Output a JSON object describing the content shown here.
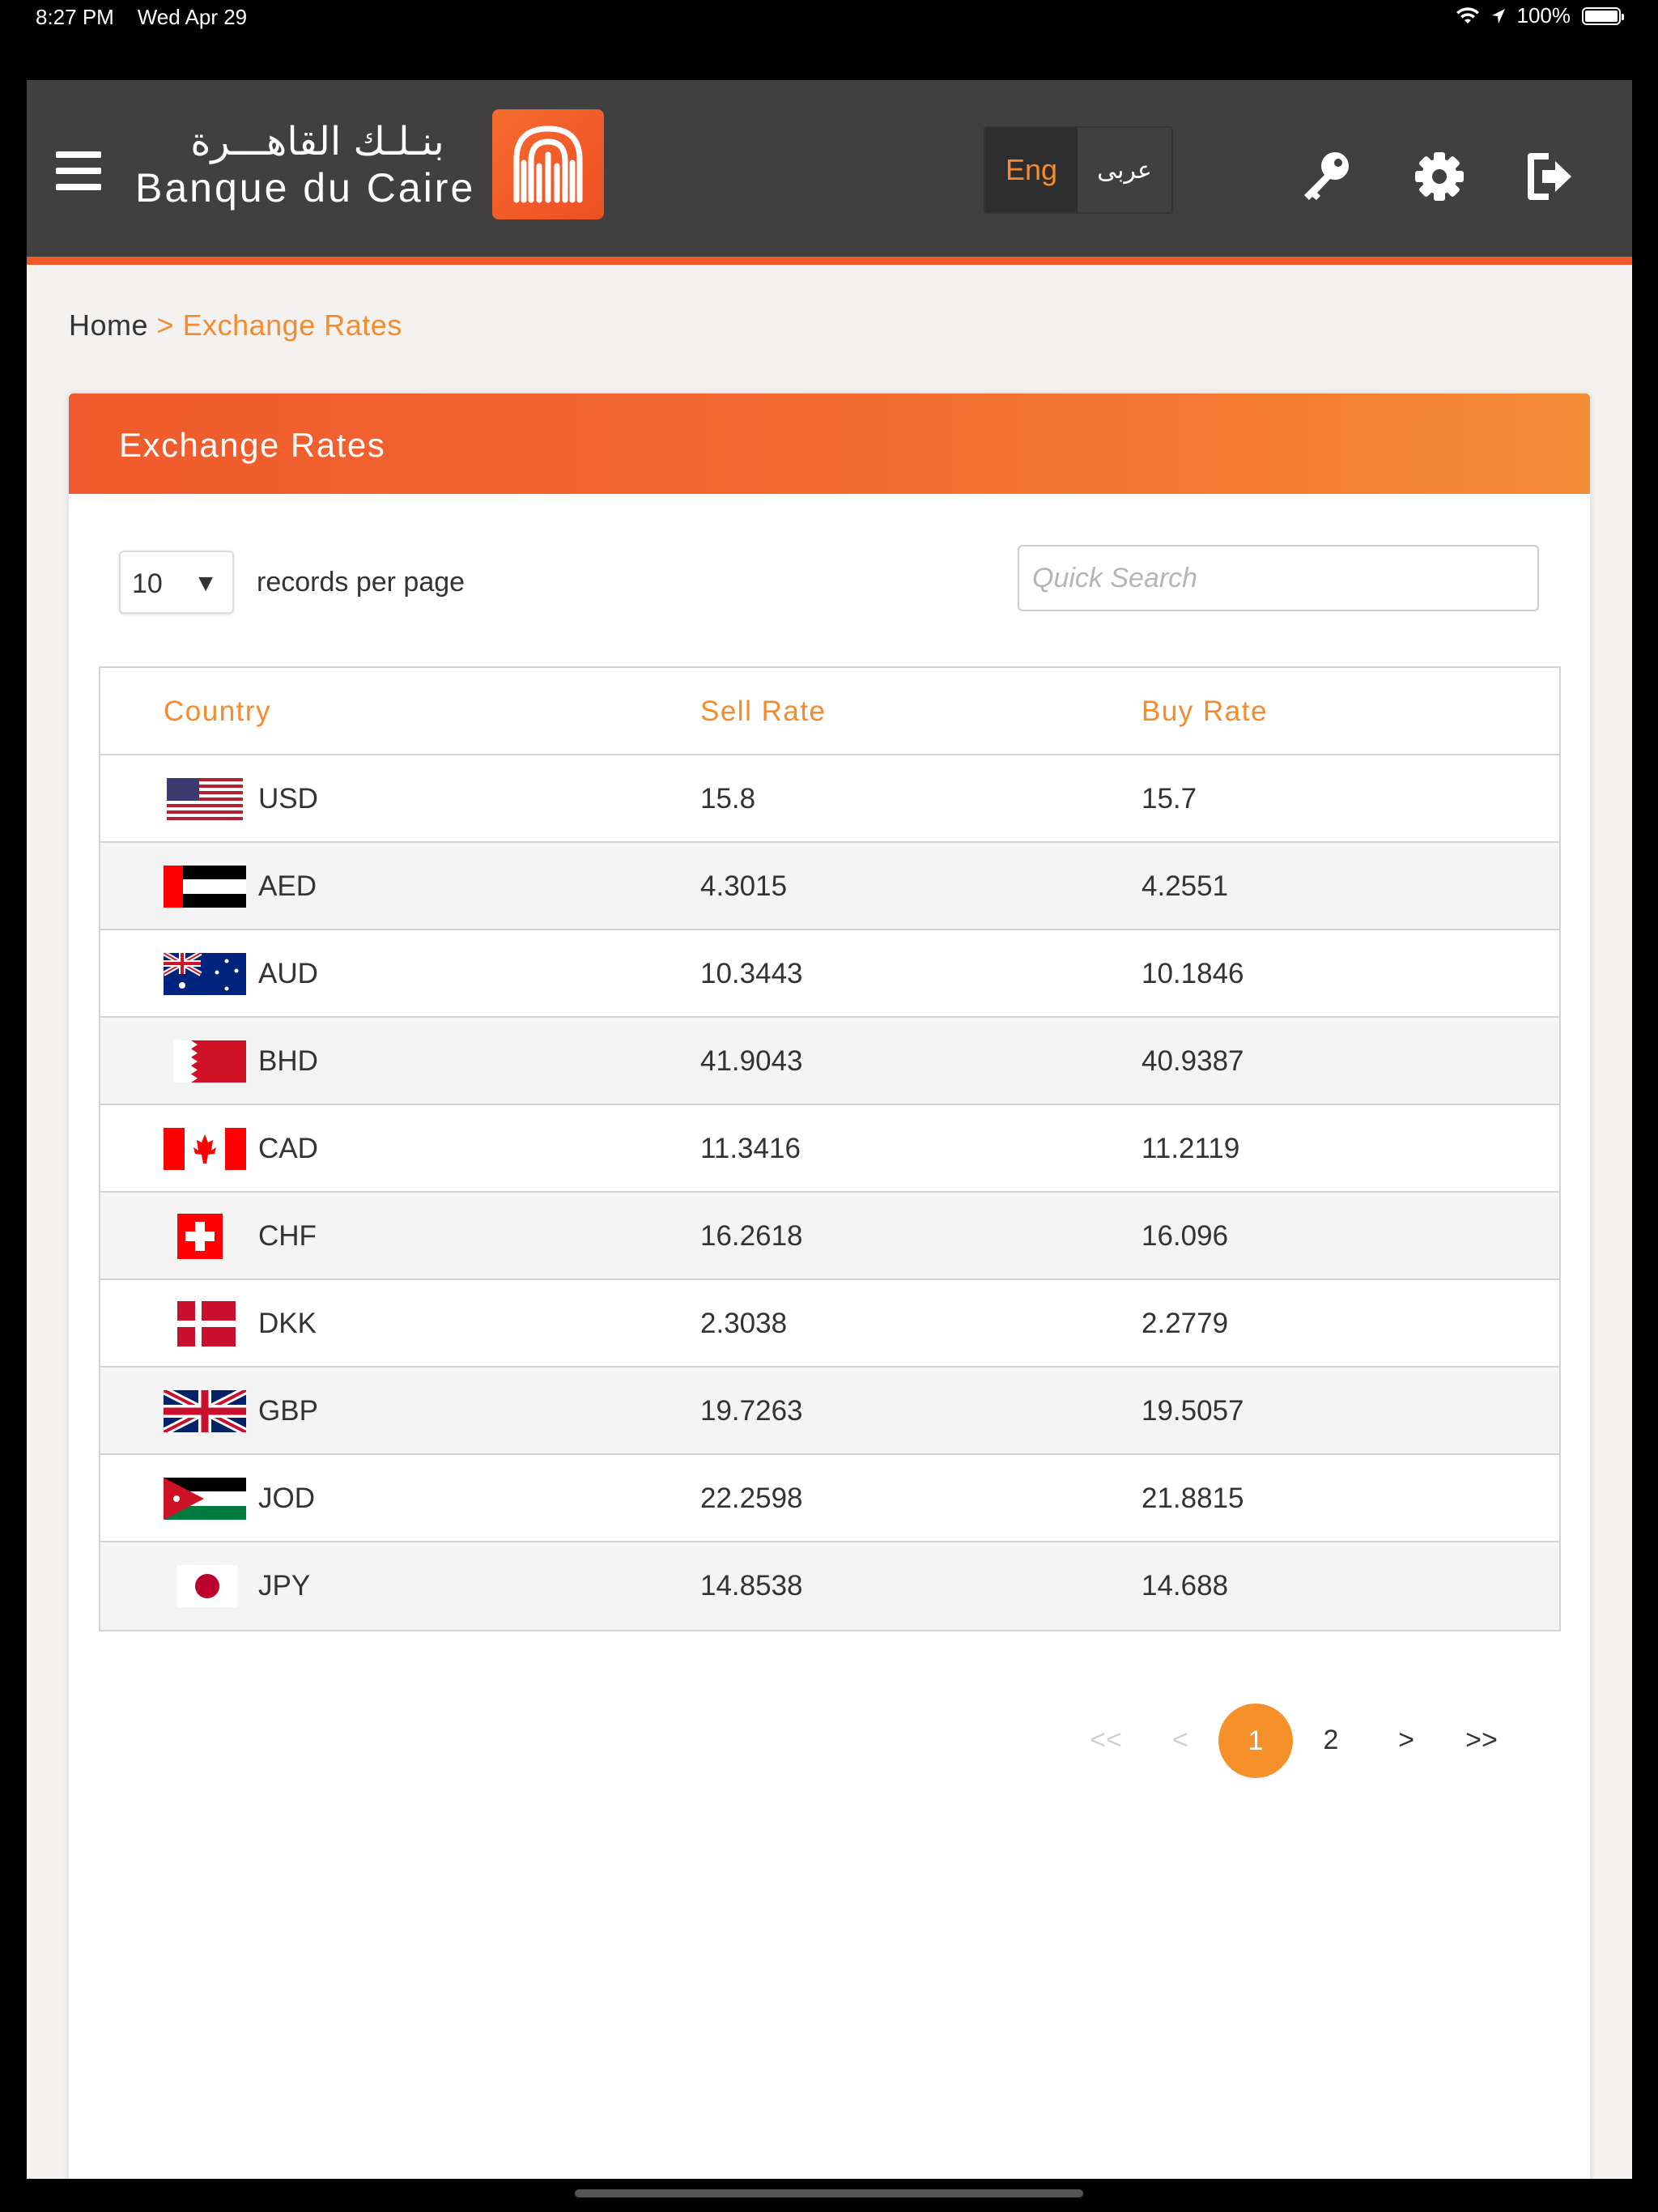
{
  "status_bar": {
    "time": "8:27 PM",
    "date": "Wed Apr 29",
    "battery": "100%"
  },
  "header": {
    "logo_arabic": "بنـلـك القاهـــرة",
    "logo_english": "Banque du Caire",
    "lang_english": "Eng",
    "lang_arabic": "عربى",
    "accent_color": "#f05a2a"
  },
  "breadcrumb": {
    "home": "Home",
    "separator": ">",
    "current": "Exchange Rates"
  },
  "card": {
    "title": "Exchange Rates",
    "records_per_page_value": "10",
    "records_per_page_arrow": "▼",
    "records_per_page_label": "records per page",
    "search_placeholder": "Quick Search"
  },
  "table": {
    "headers": [
      "Country",
      "Sell Rate",
      "Buy Rate"
    ],
    "rows": [
      {
        "code": "USD",
        "sell": "15.8",
        "buy": "15.7"
      },
      {
        "code": "AED",
        "sell": "4.3015",
        "buy": "4.2551"
      },
      {
        "code": "AUD",
        "sell": "10.3443",
        "buy": "10.1846"
      },
      {
        "code": "BHD",
        "sell": "41.9043",
        "buy": "40.9387"
      },
      {
        "code": "CAD",
        "sell": "11.3416",
        "buy": "11.2119"
      },
      {
        "code": "CHF",
        "sell": "16.2618",
        "buy": "16.096"
      },
      {
        "code": "DKK",
        "sell": "2.3038",
        "buy": "2.2779"
      },
      {
        "code": "GBP",
        "sell": "19.7263",
        "buy": "19.5057"
      },
      {
        "code": "JOD",
        "sell": "22.2598",
        "buy": "21.8815"
      },
      {
        "code": "JPY",
        "sell": "14.8538",
        "buy": "14.688"
      }
    ]
  },
  "pagination": {
    "first": "<<",
    "prev": "<",
    "pages": [
      "1",
      "2"
    ],
    "active_page": "1",
    "next": ">",
    "last": ">>"
  }
}
